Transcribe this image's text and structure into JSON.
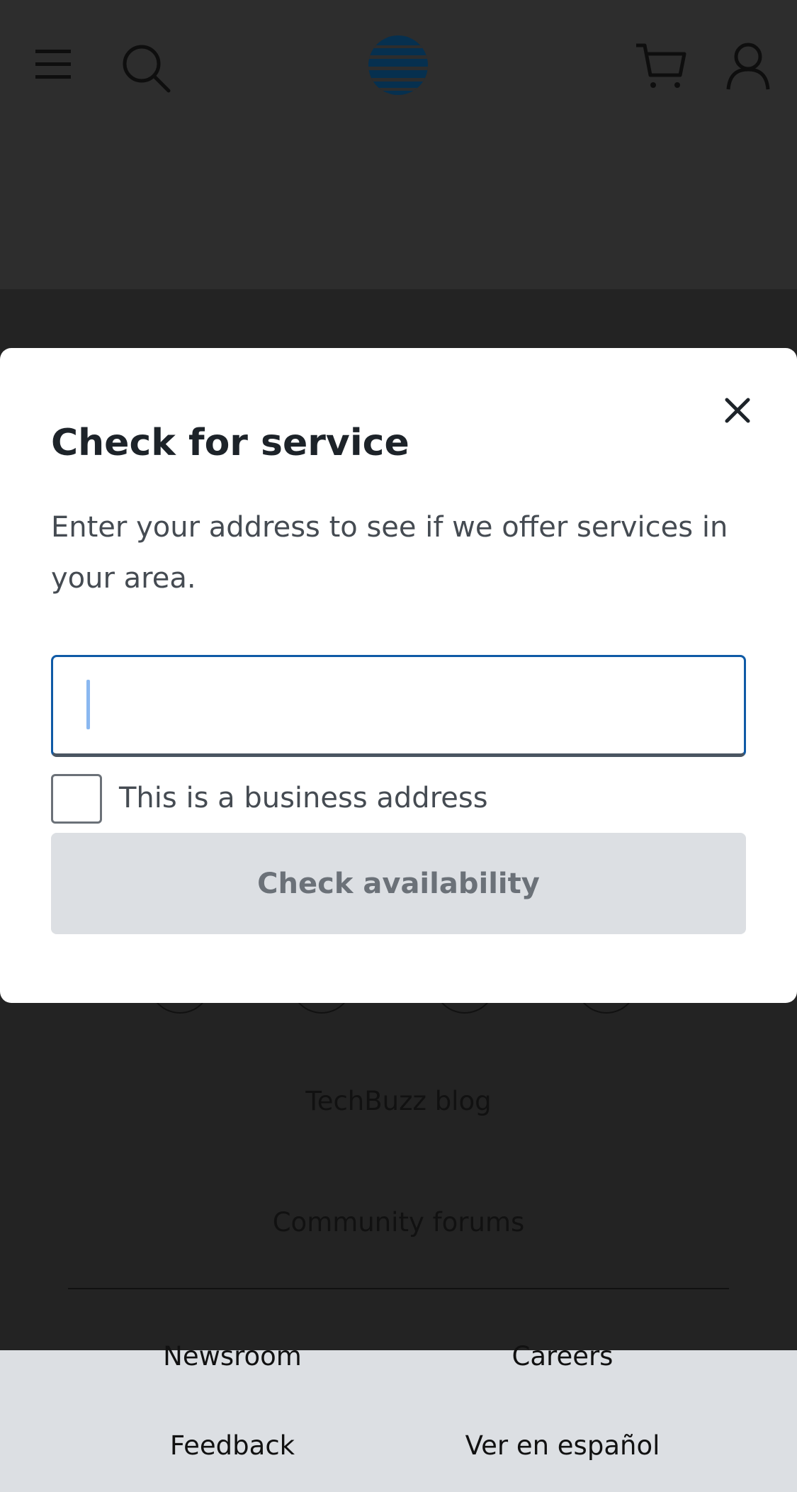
{
  "header": {
    "icons": [
      "menu-icon",
      "search-icon",
      "att-globe-logo",
      "cart-icon",
      "account-icon"
    ]
  },
  "modal": {
    "title": "Check for service",
    "description": "Enter your address to see if we offer services in your area.",
    "address_input": {
      "value": "",
      "placeholder": ""
    },
    "business_checkbox": {
      "label": "This is a business address",
      "checked": false
    },
    "check_button_label": "Check availability",
    "close_icon": "close-icon"
  },
  "footer": {
    "links": [
      "TechBuzz blog",
      "Community forums"
    ],
    "grid_links": [
      "Newsroom",
      "Careers",
      "Feedback",
      "Ver en español"
    ]
  },
  "colors": {
    "header_bg": "#2d2d2d",
    "overlay_bg": "#232323",
    "input_focus_border": "#0f5aa6",
    "button_disabled_bg": "#dcdfe3",
    "logo_blue": "#0a3f6b"
  }
}
